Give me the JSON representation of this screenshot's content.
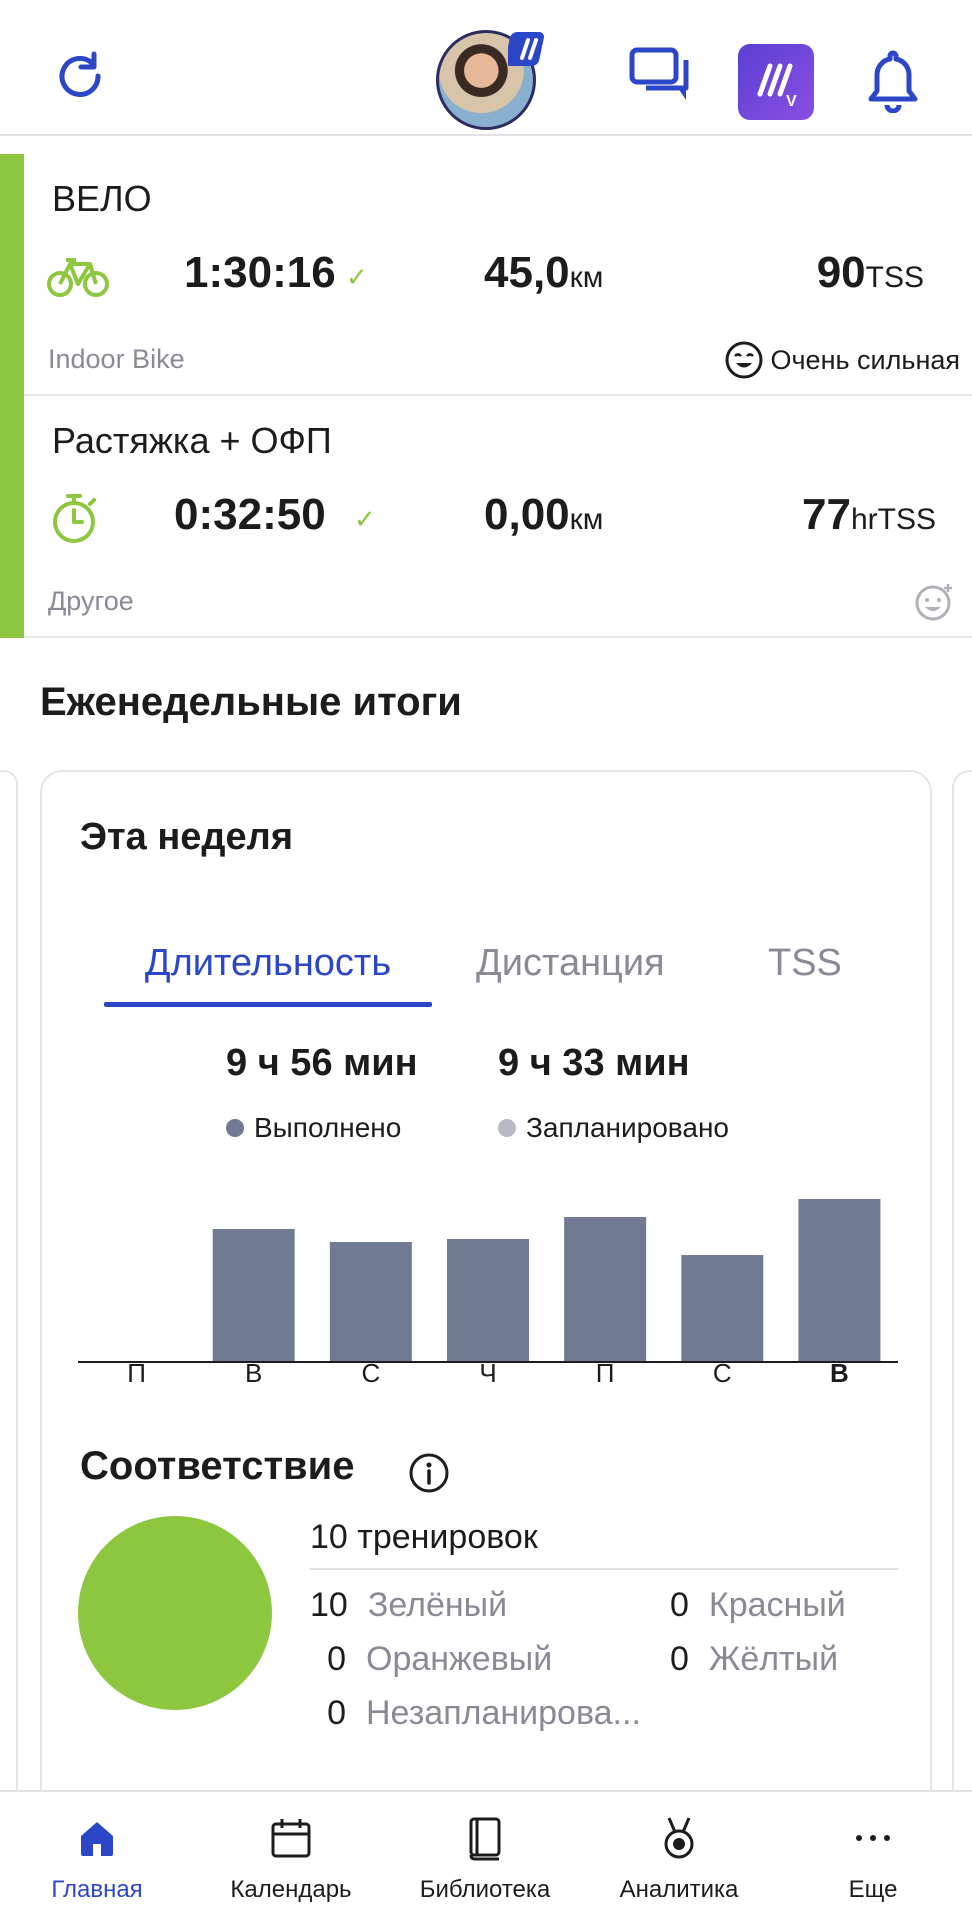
{
  "header": {
    "icons": [
      "refresh-icon",
      "avatar",
      "messages-icon",
      "app-v-icon",
      "bell-icon"
    ]
  },
  "activities": [
    {
      "title": "ВЕЛО",
      "icon": "bike-icon",
      "time": "1:30:16",
      "distance": "45,0",
      "distance_unit": "км",
      "load": "90",
      "load_unit": "TSS",
      "type": "Indoor Bike",
      "feel": "Очень сильная"
    },
    {
      "title": "Растяжка + ОФП",
      "icon": "stopwatch-icon",
      "time": "0:32:50",
      "distance": "0,00",
      "distance_unit": "км",
      "load": "77",
      "load_unit": "hrTSS",
      "type": "Другое",
      "feel": ""
    }
  ],
  "weekly": {
    "section_title": "Еженедельные итоги",
    "card_title": "Эта неделя",
    "tabs": [
      "Длительность",
      "Дистанция",
      "TSS"
    ],
    "active_tab": "Длительность",
    "completed_total": "9 ч 56 мин",
    "planned_total": "9 ч 33 мин",
    "completed_label": "Выполнено",
    "planned_label": "Запланировано",
    "colors": {
      "completed": "#717a93",
      "planned": "#b7bac6",
      "accent": "#2b47c8",
      "green": "#8dc63f"
    }
  },
  "chart_data": {
    "type": "bar",
    "categories": [
      "П",
      "В",
      "С",
      "Ч",
      "П",
      "С",
      "В"
    ],
    "values": [
      0,
      1.33,
      1.2,
      1.23,
      1.45,
      1.07,
      1.63
    ],
    "ylim": [
      0,
      1.8
    ],
    "current_day_index": 6,
    "grid": false
  },
  "compliance": {
    "title": "Соответствие",
    "count_label": "10 тренировок",
    "items": [
      {
        "num": "10",
        "label": "Зелёный"
      },
      {
        "num": "0",
        "label": "Красный"
      },
      {
        "num": "0",
        "label": "Оранжевый"
      },
      {
        "num": "0",
        "label": "Жёлтый"
      },
      {
        "num": "0",
        "label": "Незапланирова..."
      }
    ]
  },
  "nav": [
    {
      "label": "Главная",
      "icon": "home-icon",
      "active": true
    },
    {
      "label": "Календарь",
      "icon": "calendar-icon",
      "active": false
    },
    {
      "label": "Библиотека",
      "icon": "library-icon",
      "active": false
    },
    {
      "label": "Аналитика",
      "icon": "medal-icon",
      "active": false
    },
    {
      "label": "Еще",
      "icon": "more-icon",
      "active": false
    }
  ]
}
